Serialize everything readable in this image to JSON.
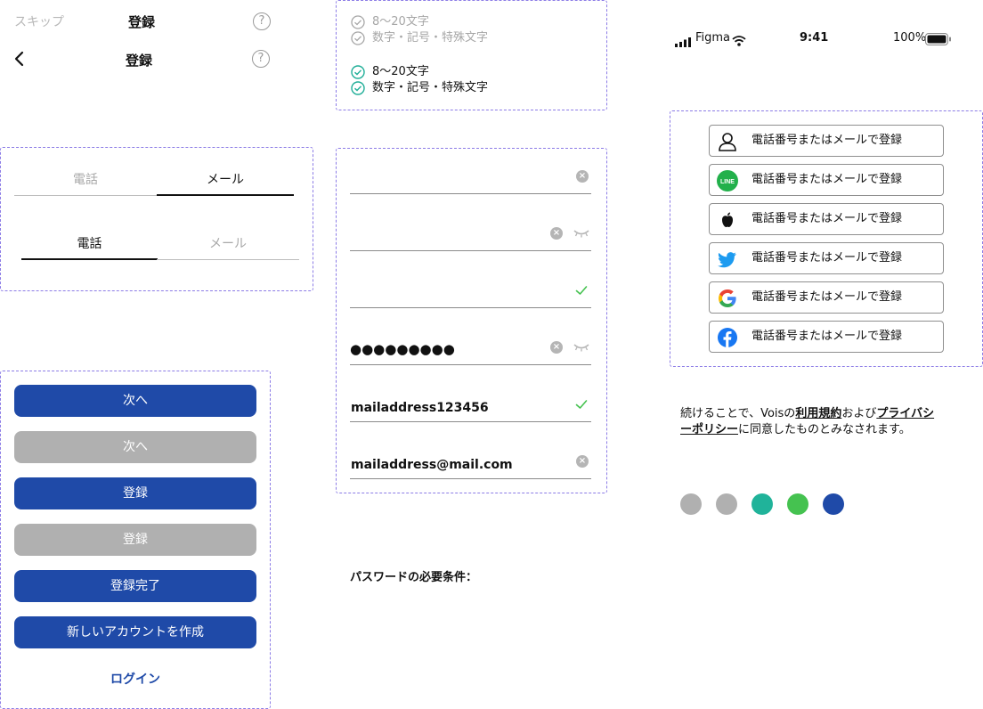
{
  "header1": {
    "skip": "スキップ",
    "title": "登録"
  },
  "header2": {
    "title": "登録"
  },
  "tabs_row1": {
    "phone": "電話",
    "mail": "メール"
  },
  "tabs_row2": {
    "phone": "電話",
    "mail": "メール"
  },
  "buttons": {
    "next_active": "次へ",
    "next_disabled": "次へ",
    "register_active": "登録",
    "register_disabled": "登録",
    "register_done": "登録完了",
    "create_account": "新しいアカウントを作成",
    "login": "ログイン"
  },
  "password_rules": {
    "unmet": [
      "8〜20文字",
      "数字・記号・特殊文字"
    ],
    "met": [
      "8〜20文字",
      "数字・記号・特殊文字"
    ],
    "heading": "パスワードの必要条件："
  },
  "inputs": {
    "masked_password": "●●●●●●●●●",
    "username": "mailaddress123456",
    "email": "mailaddress@mail.com"
  },
  "status_bar": {
    "carrier": "Figma",
    "time": "9:41",
    "battery": "100%"
  },
  "social": {
    "label": "電話番号またはメールで登録",
    "providers": [
      "person-icon",
      "line-icon",
      "apple-icon",
      "twitter-icon",
      "google-icon",
      "facebook-icon"
    ]
  },
  "terms": {
    "part1": "続けることで、Voisの",
    "link1": "利用規約",
    "part2": "および",
    "link2": "プライバシーポリシー",
    "part3": "に同意したものとみなされます。"
  },
  "colors": {
    "primary": "#1f4aa8",
    "disabled": "#b0b0b0",
    "palette": [
      "#b0b0b0",
      "#b0b0b0",
      "#20b39a",
      "#45c250",
      "#1f4aa8"
    ]
  }
}
